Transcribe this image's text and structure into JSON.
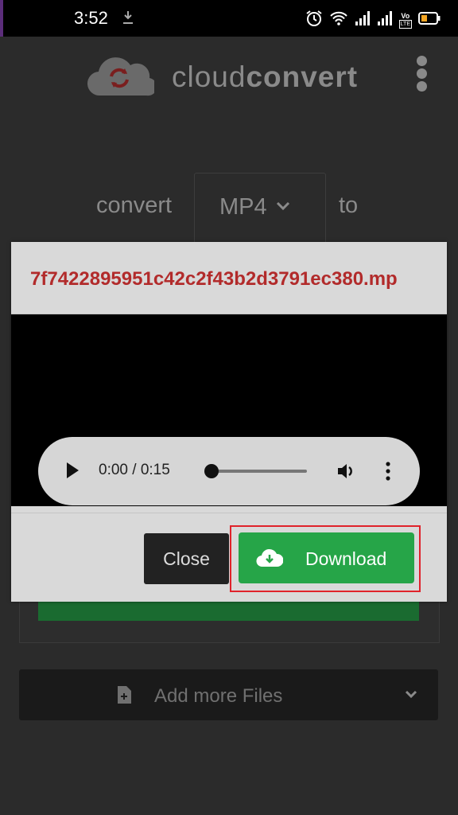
{
  "status_bar": {
    "time": "3:52",
    "icons": [
      "download-icon",
      "alarm-icon",
      "wifi-icon",
      "signal-icon",
      "signal-icon",
      "volte-icon",
      "battery-icon"
    ],
    "volte_top": "Vo",
    "volte_bottom": "LTE"
  },
  "app": {
    "brand_light": "cloud",
    "brand_bold": "convert",
    "logo_icon": "cloud-convert-logo-icon",
    "menu_icon": "kebab-menu-icon"
  },
  "converter": {
    "convert_label": "convert",
    "format": "MP4",
    "to_label": "to"
  },
  "add_more": {
    "label": "Add more Files",
    "icon": "file-plus-icon"
  },
  "modal": {
    "title": "7f7422895951c42c2f43b2d3791ec380.mp",
    "player": {
      "time": "0:00 / 0:15",
      "progress": 0
    },
    "close_label": "Close",
    "download_label": "Download",
    "download_icon": "cloud-download-icon"
  },
  "colors": {
    "title_red": "#b22b2b",
    "download_green": "#26a548",
    "highlight_red": "#e0222b"
  }
}
